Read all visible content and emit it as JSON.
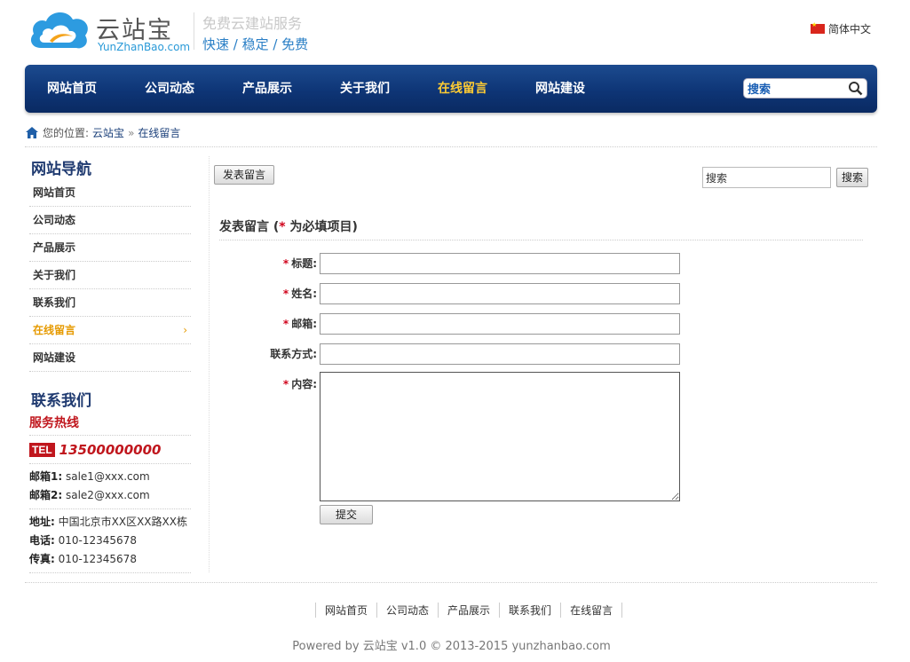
{
  "header": {
    "logo_title": "云站宝",
    "logo_sub": "YunZhanBao.com",
    "slogan_line1": "免费云建站服务",
    "slogan_line2": "快速 / 稳定 / 免费",
    "language": "简体中文"
  },
  "nav": {
    "items": [
      "网站首页",
      "公司动态",
      "产品展示",
      "关于我们",
      "在线留言",
      "网站建设"
    ],
    "active": "在线留言",
    "search_placeholder": "搜索"
  },
  "breadcrumb": {
    "prefix": "您的位置:",
    "home": "云站宝",
    "separator": "»",
    "current": "在线留言"
  },
  "sidebar": {
    "nav_title": "网站导航",
    "items": [
      "网站首页",
      "公司动态",
      "产品展示",
      "关于我们",
      "联系我们",
      "在线留言",
      "网站建设"
    ],
    "active": "在线留言",
    "contact_title": "联系我们",
    "hotline_label": "服务热线",
    "tel_badge": "TEL",
    "tel_number": "13500000000",
    "email1_label": "邮箱1:",
    "email1": "sale1@xxx.com",
    "email2_label": "邮箱2:",
    "email2": "sale2@xxx.com",
    "address_label": "地址:",
    "address": "中国北京市XX区XX路XX栋",
    "phone_label": "电话:",
    "phone": "010-12345678",
    "fax_label": "传真:",
    "fax": "010-12345678"
  },
  "main": {
    "post_button": "发表留言",
    "search_value": "搜索",
    "search_button": "搜索",
    "form_heading_pre": "发表留言 (",
    "form_heading_star": "*",
    "form_heading_post": " 为必填项目)",
    "fields": {
      "title": "标题:",
      "name": "姓名:",
      "email": "邮箱:",
      "contact": "联系方式:",
      "content": "内容:"
    },
    "required_mark": "*",
    "submit_button": "提交"
  },
  "footer": {
    "links": [
      "网站首页",
      "公司动态",
      "产品展示",
      "联系我们",
      "在线留言"
    ],
    "powered": "Powered by 云站宝 v1.0 © 2013-2015 yunzhanbao.com"
  },
  "colors": {
    "nav_bg": "#0e3576",
    "nav_active": "#ffcc33",
    "title_blue": "#1f3a70",
    "accent_red": "#c0161d",
    "sidebar_active": "#e69a00"
  }
}
